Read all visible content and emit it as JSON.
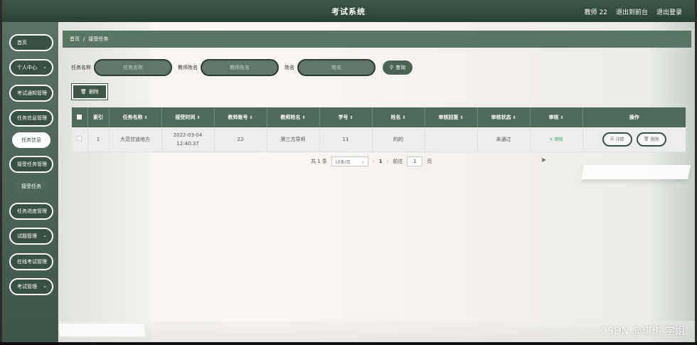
{
  "header": {
    "title": "考试系统",
    "user": "教师 22",
    "back_to_front": "退出到前台",
    "logout": "退出登录"
  },
  "sidebar": {
    "items": [
      {
        "label": "首页",
        "arrow": ""
      },
      {
        "label": "个人中心",
        "arrow": "⌄"
      },
      {
        "label": "考试通知管理",
        "arrow": ""
      },
      {
        "label": "任务信息管理",
        "arrow": ""
      },
      {
        "label": "任务信息",
        "arrow": ""
      },
      {
        "label": "接受任务管理",
        "arrow": ""
      },
      {
        "label": "接受任务",
        "arrow": ""
      },
      {
        "label": "任务进度管理",
        "arrow": ""
      },
      {
        "label": "试题管理",
        "arrow": "⌄"
      },
      {
        "label": "在线考试管理",
        "arrow": ""
      },
      {
        "label": "考试管理",
        "arrow": "⌄"
      }
    ]
  },
  "breadcrumb": {
    "home": "首页",
    "separator": "/",
    "current": "接受任务"
  },
  "search": {
    "task_name_label": "任务名称",
    "task_name_placeholder": "任务名称",
    "teacher_name_label": "教师姓名",
    "teacher_name_placeholder": "教师姓名",
    "name_label": "姓名",
    "name_placeholder": "姓名",
    "query_label": "查询"
  },
  "toolbar": {
    "delete_label": "删除"
  },
  "table": {
    "columns": [
      "索引",
      "任务名称",
      "接受时间",
      "教师账号",
      "教师姓名",
      "学号",
      "姓名",
      "审核回复",
      "审核状态",
      "审核",
      "操作"
    ],
    "rows": [
      {
        "index": "1",
        "task_name": "大范甘迪地方",
        "accept_time": "2022-03-04 12:40:37",
        "teacher_account": "22",
        "teacher_name": "第三方导师",
        "student_no": "11",
        "name": "的的",
        "audit_reply": "",
        "audit_status": "未通过",
        "audit_action": "审核",
        "detail_label": "详情",
        "delete_label": "删除"
      }
    ]
  },
  "pagination": {
    "total": "共 1 条",
    "page_size": "10条/页",
    "current_page": "1",
    "goto_prefix": "前往",
    "goto_value": "1",
    "goto_suffix": "页"
  },
  "watermark": "CSDN @琪琪 学姐",
  "colors": {
    "primary": "#3b5044",
    "header_bg": "#2c4134",
    "table_header": "#4f6a5a",
    "audit_link": "#3aa06b"
  }
}
